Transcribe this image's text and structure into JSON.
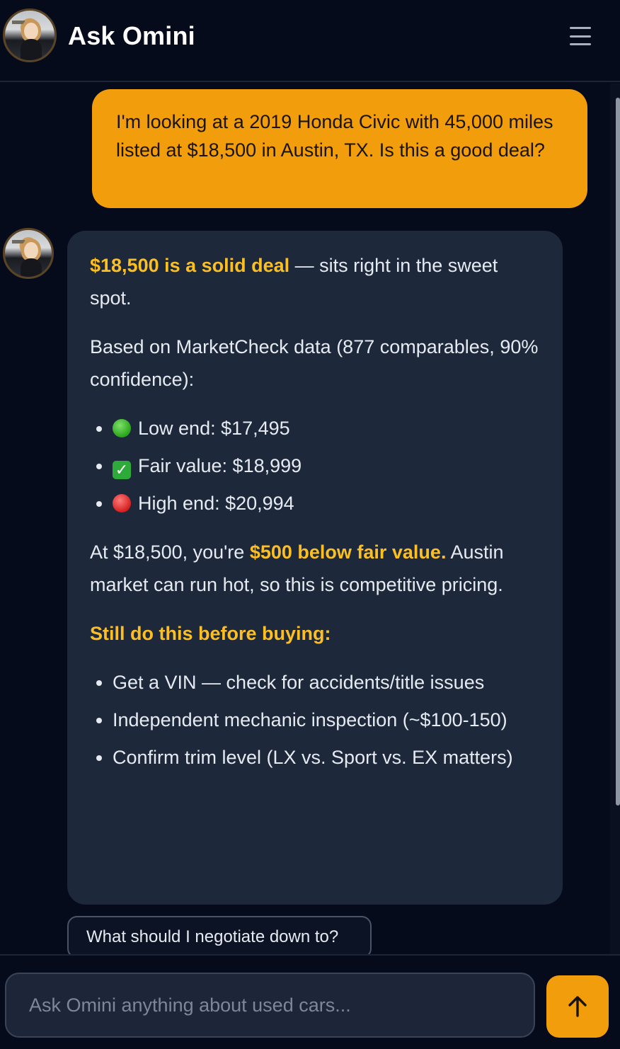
{
  "header": {
    "title": "Ask Omini",
    "avatar_icon": "profile-photo-avatar",
    "menu_icon": "hamburger-menu-icon"
  },
  "conversation": {
    "user_message": "I'm looking at a 2019 Honda Civic with 45,000 miles listed at $18,500 in Austin, TX. Is this a good deal?",
    "assistant": {
      "headline_bold": "$18,500 is a solid deal",
      "headline_rest": " — sits right in the sweet spot.",
      "basis": "Based on MarketCheck data (877 comparables, 90% confidence):",
      "price_points": [
        {
          "icon": "green-circle-icon",
          "label": "Low end: $17,495"
        },
        {
          "icon": "check-mark-icon",
          "label": "Fair value: $18,999"
        },
        {
          "icon": "red-circle-icon",
          "label": "High end: $20,994"
        }
      ],
      "verdict_prefix": "At $18,500, you're ",
      "verdict_bold": "$500 below fair value.",
      "verdict_rest": " Austin market can run hot, so this is competitive pricing.",
      "checklist_heading": "Still do this before buying:",
      "checklist": [
        "Get a VIN — check for accidents/title issues",
        "Independent mechanic inspection (~$100-150)",
        "Confirm trim level (LX vs. Sport vs. EX matters)"
      ]
    }
  },
  "suggestion_chip": "What should I negotiate down to?",
  "composer": {
    "placeholder": "Ask Omini anything about used cars...",
    "send_icon": "arrow-up-icon"
  },
  "colors": {
    "accent": "#f29d0c",
    "highlight": "#fbbf24",
    "background": "#050b1b",
    "bubble": "#1e283b"
  }
}
